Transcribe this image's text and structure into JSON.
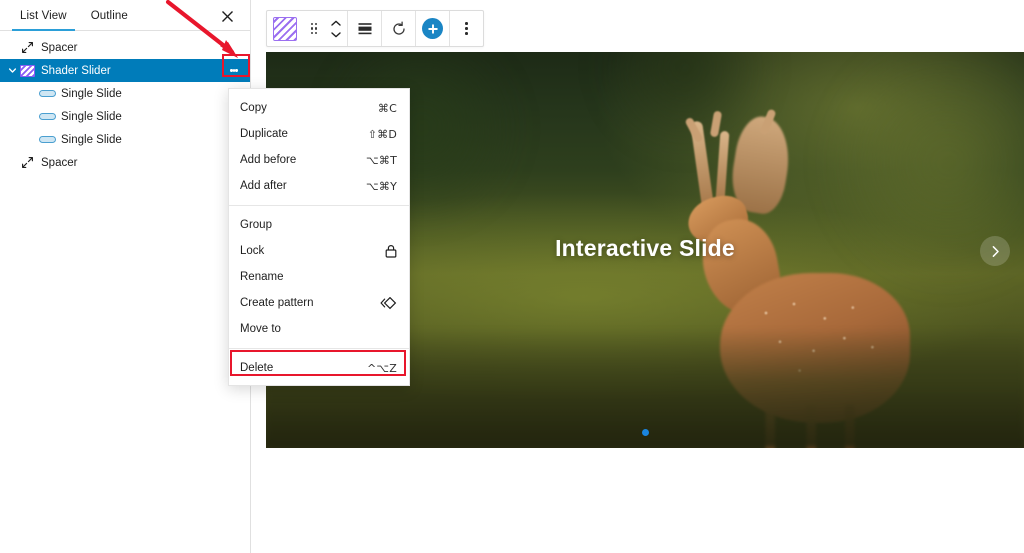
{
  "sidebar": {
    "tabs": [
      {
        "label": "List View",
        "active": true
      },
      {
        "label": "Outline",
        "active": false
      }
    ],
    "close_label": "Close",
    "rows": [
      {
        "label": "Spacer",
        "icon": "resize-diagonal-icon",
        "indent": 0,
        "selected": false
      },
      {
        "label": "Shader Slider",
        "icon": "shader-slider-icon",
        "indent": 0,
        "selected": true
      },
      {
        "label": "Single Slide",
        "icon": "single-slide-icon",
        "indent": 1,
        "selected": false
      },
      {
        "label": "Single Slide",
        "icon": "single-slide-icon",
        "indent": 1,
        "selected": false
      },
      {
        "label": "Single Slide",
        "icon": "single-slide-icon",
        "indent": 1,
        "selected": false
      },
      {
        "label": "Spacer",
        "icon": "resize-diagonal-icon",
        "indent": 0,
        "selected": false
      }
    ]
  },
  "context_menu": {
    "groups": [
      [
        {
          "label": "Copy",
          "shortcut": "⌘C",
          "icon": ""
        },
        {
          "label": "Duplicate",
          "shortcut": "⇧⌘D",
          "icon": ""
        },
        {
          "label": "Add before",
          "shortcut": "⌥⌘T",
          "icon": ""
        },
        {
          "label": "Add after",
          "shortcut": "⌥⌘Y",
          "icon": ""
        }
      ],
      [
        {
          "label": "Group",
          "shortcut": "",
          "icon": ""
        },
        {
          "label": "Lock",
          "shortcut": "",
          "icon": "lock-icon"
        },
        {
          "label": "Rename",
          "shortcut": "",
          "icon": ""
        },
        {
          "label": "Create pattern",
          "shortcut": "",
          "icon": "pattern-icon"
        },
        {
          "label": "Move to",
          "shortcut": "",
          "icon": ""
        }
      ],
      [
        {
          "label": "Delete",
          "shortcut": "^⌥Z",
          "icon": ""
        }
      ]
    ]
  },
  "toolbar": {
    "block_icon_name": "shader-slider-block-icon",
    "drag_label": "Drag",
    "move_up_label": "Move up",
    "move_down_label": "Move down",
    "align_label": "Change alignment",
    "refresh_label": "Refresh",
    "add_label": "Add",
    "more_label": "Options"
  },
  "slide": {
    "title": "Interactive Slide",
    "next_label": "Next slide",
    "dots": [
      {
        "active": true
      }
    ]
  },
  "colors": {
    "accent_blue": "#007cba",
    "tab_underline": "#2b9fd8",
    "annotation_red": "#e8162c",
    "block_purple": "#9b6ff0",
    "dot_blue": "#1a85e0",
    "toolbar_add": "#1a85c4"
  }
}
